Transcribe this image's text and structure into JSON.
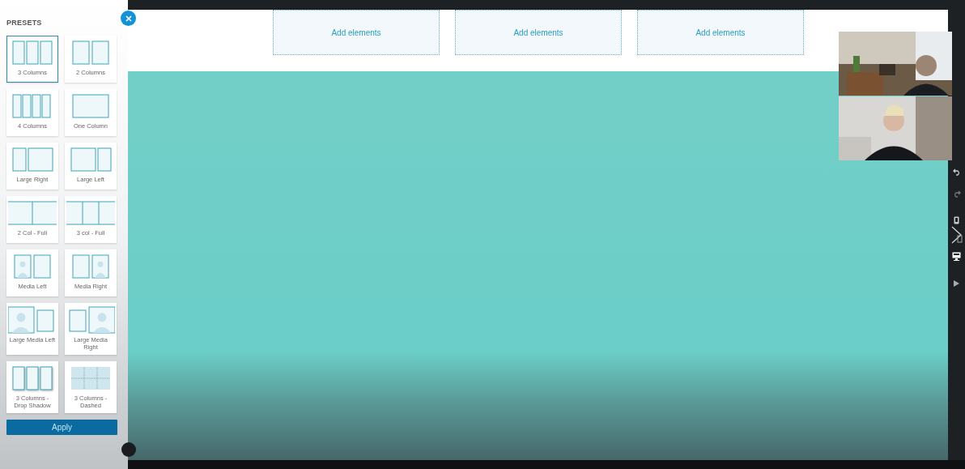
{
  "presets": {
    "title": "PRESETS",
    "items": [
      {
        "label": "3 Columns",
        "kind": "cols3",
        "selected": true
      },
      {
        "label": "2 Columns",
        "kind": "cols2",
        "selected": false
      },
      {
        "label": "4 Columns",
        "kind": "cols4",
        "selected": false
      },
      {
        "label": "One Column",
        "kind": "one",
        "selected": false
      },
      {
        "label": "Large Right",
        "kind": "large-right",
        "selected": false
      },
      {
        "label": "Large Left",
        "kind": "large-left",
        "selected": false
      },
      {
        "label": "2 Col - Full",
        "kind": "full2",
        "selected": false
      },
      {
        "label": "3 col - Full",
        "kind": "full3",
        "selected": false
      },
      {
        "label": "Media Left",
        "kind": "media-left",
        "selected": false
      },
      {
        "label": "Media Right",
        "kind": "media-right",
        "selected": false
      },
      {
        "label": "Large Media Left",
        "kind": "large-media-left",
        "selected": false
      },
      {
        "label": "Large Media Right",
        "kind": "large-media-right",
        "selected": false
      },
      {
        "label": "3 Columns - Drop Shadow",
        "kind": "shadow3",
        "selected": false
      },
      {
        "label": "3 Columns - Dashed",
        "kind": "dashed3",
        "selected": false
      }
    ],
    "apply": "Apply"
  },
  "canvas": {
    "columns": [
      "Add elements",
      "Add elements",
      "Add elements"
    ]
  }
}
